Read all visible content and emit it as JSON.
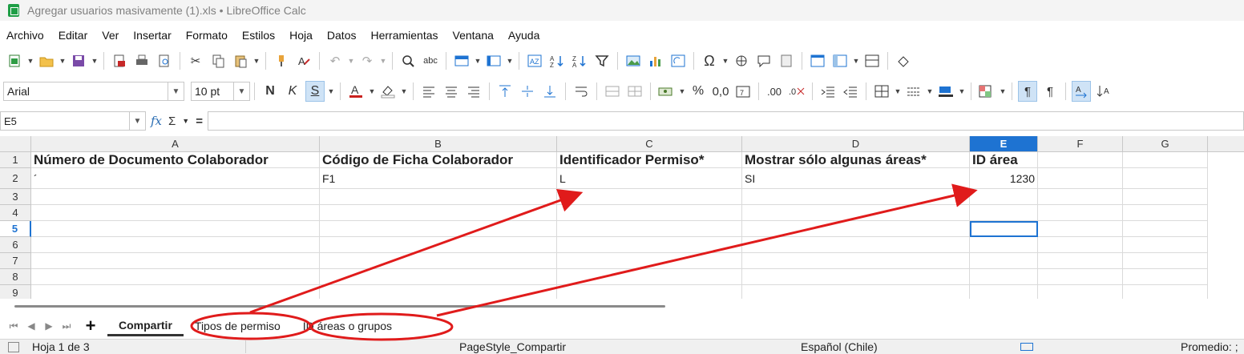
{
  "window": {
    "title": "Agregar usuarios masivamente (1).xls • LibreOffice Calc"
  },
  "menu": [
    "Archivo",
    "Editar",
    "Ver",
    "Insertar",
    "Formato",
    "Estilos",
    "Hoja",
    "Datos",
    "Herramientas",
    "Ventana",
    "Ayuda"
  ],
  "format_toolbar": {
    "font_name": "Arial",
    "font_size": "10 pt",
    "bold_label": "N",
    "italic_label": "K",
    "underline_label": "S",
    "percent_label": "%",
    "decimal_label": "0,0"
  },
  "formula_bar": {
    "cell_ref": "E5",
    "fx_label": "fx",
    "sum_label": "Σ",
    "equals_label": "=",
    "formula": ""
  },
  "grid": {
    "columns": [
      "A",
      "B",
      "C",
      "D",
      "E",
      "F",
      "G"
    ],
    "selected_column": "E",
    "rows": [
      "1",
      "2",
      "3",
      "4",
      "5",
      "6",
      "7",
      "8",
      "9"
    ],
    "selected_row": "5",
    "row1": {
      "A": "Número de Documento Colaborador",
      "B": "Código de Ficha Colaborador",
      "C": "Identificador Permiso*",
      "D": "Mostrar sólo algunas áreas*",
      "E": "ID área"
    },
    "row2": {
      "A": "´",
      "B": "F1",
      "C": "L",
      "D": "SI",
      "E": "1230"
    }
  },
  "sheets": {
    "tabs": [
      "Compartir",
      "Tipos de permiso",
      "ID áreas o grupos"
    ],
    "active": "Compartir"
  },
  "status": {
    "sheet_info": "Hoja 1 de 3",
    "page_style": "PageStyle_Compartir",
    "language": "Español (Chile)",
    "summary": "Promedio: ;"
  },
  "annotation": {
    "color": "#e01b1b"
  }
}
